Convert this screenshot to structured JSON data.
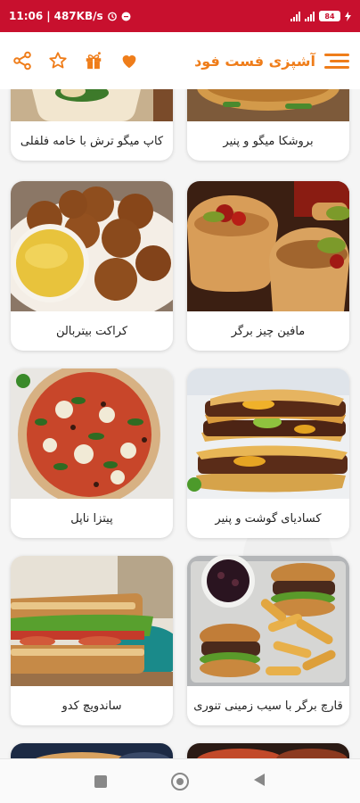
{
  "status": {
    "time": "11:06",
    "speed": "487KB/s",
    "battery": "84"
  },
  "app": {
    "title": "آشپزی فست فود",
    "menu_icon": "hamburger-menu-icon",
    "actions": [
      "share-icon",
      "star-icon",
      "gift-icon",
      "heart-icon"
    ],
    "accent": "#ef7d1a",
    "status_color": "#c8102e"
  },
  "recipes": [
    {
      "title": "بروشکا میگو و پنیر"
    },
    {
      "title": "کاپ میگو ترش با خامه فلفلی"
    },
    {
      "title": "مافین چیز برگر"
    },
    {
      "title": "کراکت بیتربالن"
    },
    {
      "title": "کسادیای گوشت و پنیر"
    },
    {
      "title": "پیتزا ناپل"
    },
    {
      "title": "قارچ برگر با سیب زمینی تنوری"
    },
    {
      "title": "ساندویچ کدو"
    }
  ],
  "navbar": {
    "icons": [
      "recents-square-icon",
      "home-circle-icon",
      "back-triangle-icon"
    ]
  }
}
